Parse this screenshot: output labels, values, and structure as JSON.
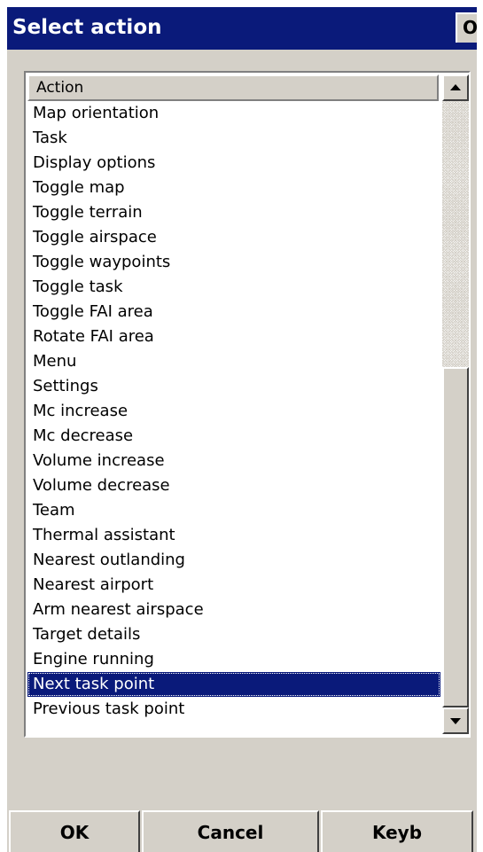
{
  "titlebar": {
    "title": "Select action",
    "ok_label": "OK"
  },
  "list": {
    "header": "Action",
    "items": [
      "Map orientation",
      "Task",
      "Display options",
      "Toggle map",
      "Toggle terrain",
      "Toggle airspace",
      "Toggle waypoints",
      "Toggle task",
      "Toggle FAI area",
      "Rotate FAI area",
      "Menu",
      "Settings",
      "Mc increase",
      "Mc decrease",
      "Volume increase",
      "Volume decrease",
      "Team",
      "Thermal assistant",
      "Nearest outlanding",
      "Nearest airport",
      "Arm nearest airspace",
      "Target details",
      "Engine running",
      "Next task point",
      "Previous task point"
    ],
    "selected": "Next task point"
  },
  "scrollbar": {
    "up_icon": "scroll-up-arrow-icon",
    "down_icon": "scroll-down-arrow-icon"
  },
  "buttons": {
    "ok": "OK",
    "cancel": "Cancel",
    "keyb": "Keyb"
  },
  "colors": {
    "titlebar": "#0a1a7a",
    "selection": "#0a1a7a",
    "window": "#d4d0c8"
  }
}
